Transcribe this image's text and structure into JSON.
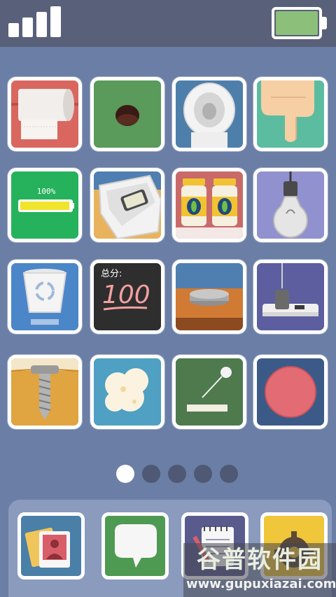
{
  "status_bar": {
    "signal_icon": "signal-bars-icon",
    "battery_icon": "battery-icon",
    "battery_level": 1.0,
    "battery_color": "#8bbf7a"
  },
  "apps": [
    {
      "name": "toilet-paper-app",
      "icon": "toilet-paper-icon",
      "bg": "#d9675f"
    },
    {
      "name": "hole-app",
      "icon": "hole-icon",
      "bg": "#5a9a5a"
    },
    {
      "name": "toilet-app",
      "icon": "toilet-icon",
      "bg": "#4e7faa"
    },
    {
      "name": "finger-app",
      "icon": "pointing-finger-icon",
      "bg": "#5cbca0"
    },
    {
      "name": "charging-app",
      "icon": "battery-charge-icon",
      "bg": "#26b25c",
      "label": "100%",
      "level": 1.0
    },
    {
      "name": "phone-box-app",
      "icon": "phone-in-box-icon",
      "bg": "#e9b25d"
    },
    {
      "name": "pickle-jars-app",
      "icon": "pickle-jars-icon",
      "bg": "#c96a69"
    },
    {
      "name": "light-bulb-app",
      "icon": "light-bulb-icon",
      "bg": "#9291cf"
    },
    {
      "name": "recycle-bin-app",
      "icon": "recycle-bin-icon",
      "bg": "#4b86c9"
    },
    {
      "name": "score-app",
      "icon": "chalkboard-score-icon",
      "bg": "#2e2e2e",
      "label": "总分:",
      "score": "100"
    },
    {
      "name": "coin-table-app",
      "icon": "coin-on-table-icon",
      "bg": "#d07a34"
    },
    {
      "name": "power-strip-app",
      "icon": "power-strip-icon",
      "bg": "#5c5ea0"
    },
    {
      "name": "screw-app",
      "icon": "screw-icon",
      "bg": "#e0a440"
    },
    {
      "name": "popcorn-app",
      "icon": "popcorn-icon",
      "bg": "#4fa0c2"
    },
    {
      "name": "ping-pong-app",
      "icon": "ball-paddle-icon",
      "bg": "#4e7a4e"
    },
    {
      "name": "red-circle-app",
      "icon": "red-circle-icon",
      "bg": "#3c5a88"
    }
  ],
  "pager": {
    "count": 5,
    "active": 0
  },
  "dock": [
    {
      "name": "photos-app",
      "icon": "photos-icon",
      "bg": "#4a7fa8"
    },
    {
      "name": "messages-app",
      "icon": "speech-bubble-icon",
      "bg": "#4e9a52"
    },
    {
      "name": "notes-app",
      "icon": "notepad-icon",
      "bg": "#595b8c"
    },
    {
      "name": "settings-app",
      "icon": "gear-icon",
      "bg": "#f0c63a"
    }
  ],
  "watermark": {
    "title": "谷普软件园",
    "url": "www.gupuxiazai.com"
  }
}
